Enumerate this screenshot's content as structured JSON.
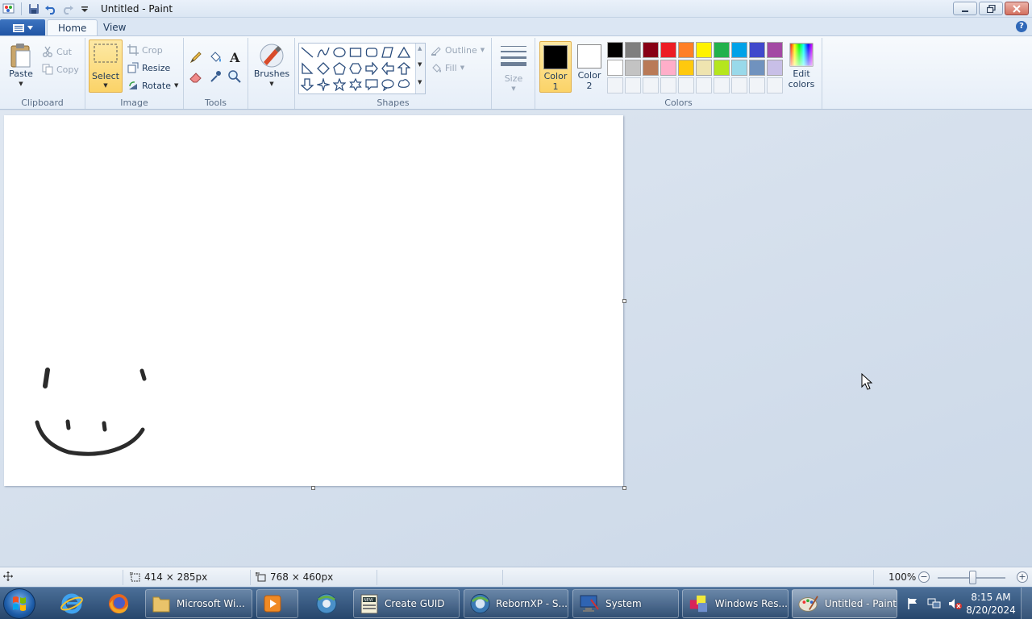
{
  "window": {
    "title": "Untitled - Paint"
  },
  "tabs": [
    {
      "label": "Home",
      "active": true
    },
    {
      "label": "View",
      "active": false
    }
  ],
  "ribbon": {
    "clipboard": {
      "label": "Clipboard",
      "paste": "Paste",
      "cut": "Cut",
      "copy": "Copy"
    },
    "image": {
      "label": "Image",
      "select": "Select",
      "crop": "Crop",
      "resize": "Resize",
      "rotate": "Rotate"
    },
    "tools": {
      "label": "Tools"
    },
    "brushes": {
      "label": "Brushes"
    },
    "shapes": {
      "label": "Shapes",
      "outline": "Outline",
      "fill": "Fill"
    },
    "size": {
      "label": "Size"
    },
    "colors": {
      "label": "Colors",
      "color1_label": "Color",
      "color1_num": "1",
      "color2_label": "Color",
      "color2_num": "2",
      "edit_label": "Edit",
      "edit_label2": "colors",
      "color1_value": "#000000",
      "color2_value": "#ffffff",
      "palette": [
        "#000000",
        "#7f7f7f",
        "#880015",
        "#ed1c24",
        "#ff7f27",
        "#fff200",
        "#22b14c",
        "#00a2e8",
        "#3f48cc",
        "#a349a4",
        "#ffffff",
        "#c3c3c3",
        "#b97a57",
        "#ffaec9",
        "#ffc90e",
        "#efe4b0",
        "#b5e61d",
        "#99d9ea",
        "#7092be",
        "#c8bfe7",
        "#f1f4f8",
        "#f1f4f8",
        "#f1f4f8",
        "#f1f4f8",
        "#f1f4f8",
        "#f1f4f8",
        "#f1f4f8",
        "#f1f4f8",
        "#f1f4f8",
        "#f1f4f8"
      ]
    }
  },
  "statusbar": {
    "selection_size": "414 × 285px",
    "canvas_size": "768 × 460px",
    "zoom": "100%",
    "zoom_minus": "−",
    "zoom_plus": "+"
  },
  "taskbar": {
    "items": [
      {
        "label": "Microsoft Wi..."
      },
      {
        "label": "Create GUID"
      },
      {
        "label": "RebornXP - S..."
      },
      {
        "label": "System"
      },
      {
        "label": "Windows Res..."
      },
      {
        "label": "Untitled - Paint"
      }
    ],
    "clock_time": "8:15 AM",
    "clock_date": "8/20/2024"
  },
  "icons": {
    "qat": [
      "paint-app-icon",
      "save-icon",
      "undo-icon",
      "redo-icon",
      "customize-qat-icon"
    ],
    "window_controls": [
      "minimize-icon",
      "restore-icon",
      "close-icon"
    ]
  }
}
